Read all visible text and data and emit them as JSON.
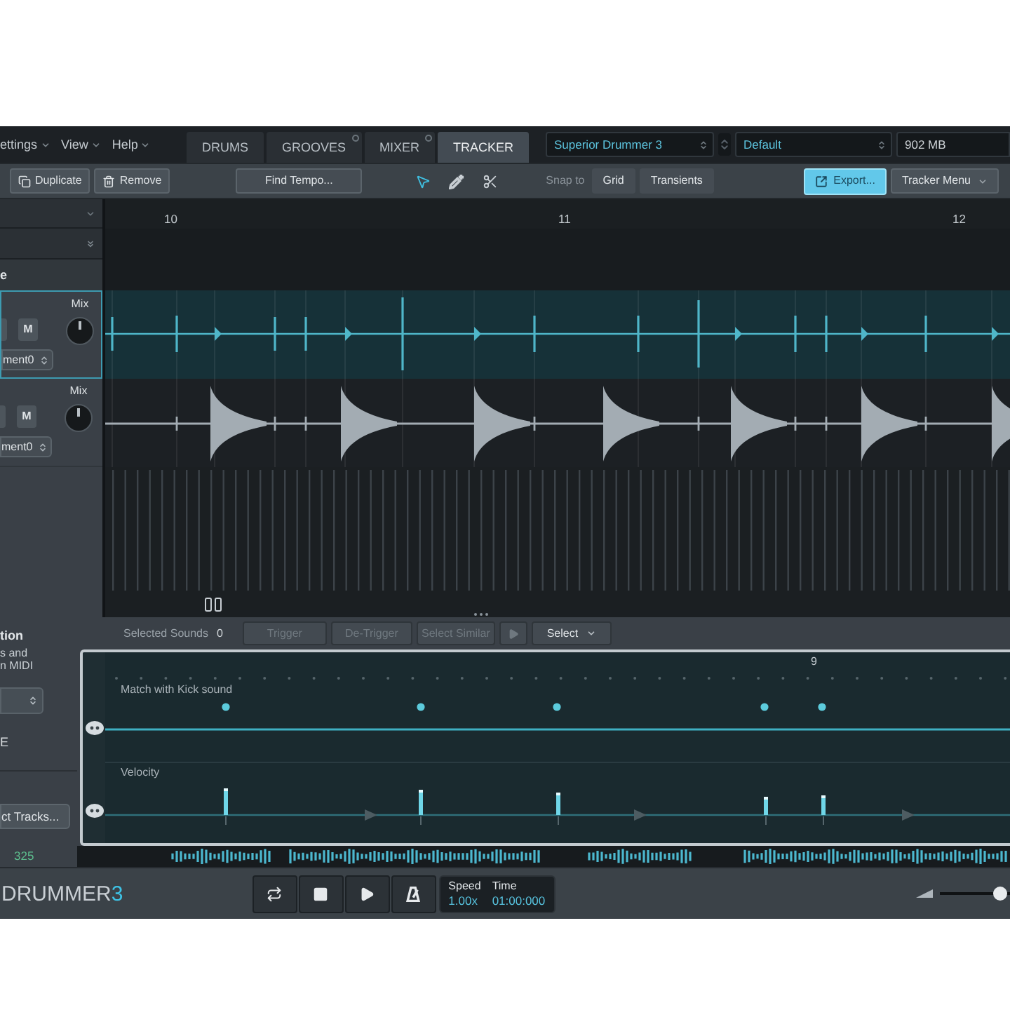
{
  "menu": [
    {
      "label": "ettings"
    },
    {
      "label": "View"
    },
    {
      "label": "Help"
    }
  ],
  "tabs": [
    {
      "label": "DRUMS",
      "selected": false,
      "indicator": false
    },
    {
      "label": "GROOVES",
      "selected": false,
      "indicator": true
    },
    {
      "label": "MIXER",
      "selected": false,
      "indicator": true
    },
    {
      "label": "TRACKER",
      "selected": true,
      "indicator": false
    }
  ],
  "preset_fields": [
    {
      "value": "Superior Drummer 3"
    },
    {
      "value": "Default"
    }
  ],
  "memory": "902 MB",
  "toolbar": {
    "edit_buttons": [
      {
        "label": "Duplicate",
        "kind": "duplicate"
      },
      {
        "label": "Remove",
        "kind": "remove"
      }
    ],
    "find_tempo": "Find Tempo...",
    "tools": [
      {
        "kind": "pointer",
        "selected": true
      },
      {
        "kind": "pen",
        "selected": false
      },
      {
        "kind": "scissors",
        "selected": false
      }
    ],
    "snap_label": "Snap to",
    "snap_options": [
      {
        "label": "Grid",
        "selected": false
      },
      {
        "label": "Transients",
        "selected": false
      }
    ],
    "export": "Export...",
    "menu_button": "Tracker Menu"
  },
  "ruler": [
    "10",
    "11",
    "12"
  ],
  "row_label": "e",
  "tracks": [
    {
      "selected": true,
      "kind": "clicks",
      "mute": "M",
      "mix_label": "Mix",
      "output": "ment0"
    },
    {
      "selected": false,
      "kind": "decay",
      "mute": "M",
      "mix_label": "Mix",
      "output": "ment0"
    }
  ],
  "side_panel": {
    "heading": "tion",
    "description": [
      "s and",
      "n MIDI"
    ],
    "label": "E",
    "tracks_button": "ct Tracks...",
    "count": "325"
  },
  "sound_bar": {
    "label": "Selected Sounds",
    "count": "0",
    "actions": [
      {
        "kind": "text",
        "label": "Trigger",
        "disabled": true
      },
      {
        "kind": "text",
        "label": "De-Trigger",
        "disabled": true
      },
      {
        "kind": "text",
        "label": "Select Similar",
        "disabled": true
      },
      {
        "kind": "play",
        "disabled": true
      }
    ],
    "select": "Select"
  },
  "lanes": {
    "ruler": "9",
    "items": [
      {
        "kind": "dots",
        "label": "Match with Kick sound"
      },
      {
        "kind": "bars",
        "label": "Velocity"
      }
    ]
  },
  "logo": {
    "name": "DRUMMER",
    "version": "3"
  },
  "transport": [
    {
      "kind": "loop"
    },
    {
      "kind": "stop"
    },
    {
      "kind": "play"
    },
    {
      "kind": "metronome"
    }
  ],
  "readouts": [
    {
      "label": "Speed",
      "value": "1.00x"
    },
    {
      "label": "Time",
      "value": "01:00:000"
    }
  ],
  "volume": {
    "level": 0.96
  }
}
